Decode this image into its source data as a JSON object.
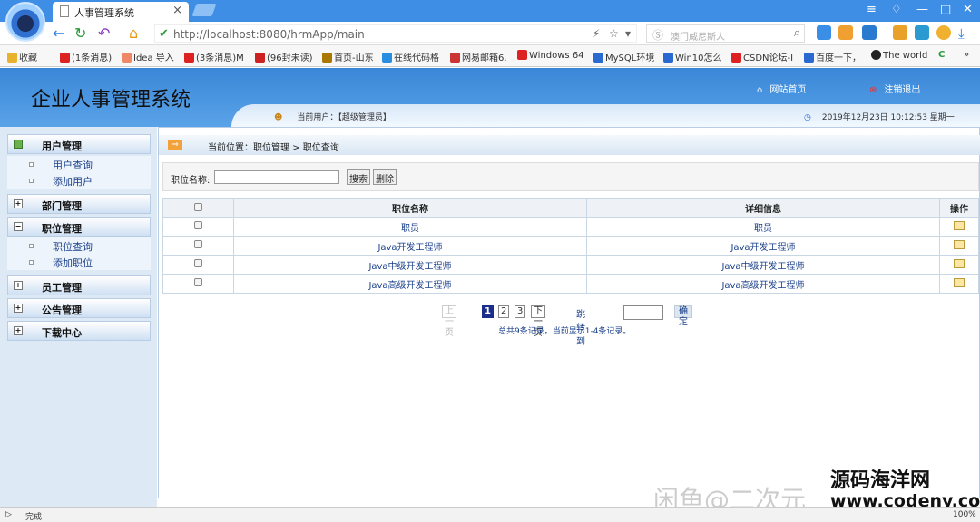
{
  "browser": {
    "tab_title": "人事管理系统",
    "tab_close": "×",
    "url_host": "http://localhost:8080",
    "url_path": "/hrmApp/main",
    "search_placeholder": "澳门威尼斯人",
    "min": "—",
    "max": "□",
    "close": "✕"
  },
  "bookmarks": [
    {
      "label": "收藏",
      "color": "#e8b22f"
    },
    {
      "label": "(1条消息)",
      "color": "#d22"
    },
    {
      "label": "Idea 导入",
      "color": "#e86"
    },
    {
      "label": "(3条消息)M",
      "color": "#d22"
    },
    {
      "label": "(96封未读)",
      "color": "#c22"
    },
    {
      "label": "首页-山东",
      "color": "#a70"
    },
    {
      "label": "在线代码格",
      "color": "#2a8ee0"
    },
    {
      "label": "网易邮箱6.",
      "color": "#c33"
    },
    {
      "label": "Windows 64",
      "color": "#d22"
    },
    {
      "label": "MySQL环境",
      "color": "#2a6ad0"
    },
    {
      "label": "Win10怎么",
      "color": "#2a6ad0"
    },
    {
      "label": "CSDN论坛-I",
      "color": "#d22"
    },
    {
      "label": "百度一下，",
      "color": "#2a6ad0"
    },
    {
      "label": "The world",
      "color": "#222"
    }
  ],
  "header": {
    "title": "企业人事管理系统",
    "home_label": "网站首页",
    "logout_label": "注销退出",
    "user_label": "当前用户：【超级管理员】",
    "datetime": "2019年12月23日  10:12:53  星期一"
  },
  "sidebar": {
    "sections": [
      {
        "label": "用户管理",
        "items": [
          "用户查询",
          "添加用户"
        ]
      },
      {
        "label": "部门管理"
      },
      {
        "label": "职位管理",
        "items": [
          "职位查询",
          "添加职位"
        ]
      },
      {
        "label": "员工管理"
      },
      {
        "label": "公告管理"
      },
      {
        "label": "下载中心"
      }
    ]
  },
  "breadcrumb": "当前位置：职位管理 > 职位查询",
  "form": {
    "name_label": "职位名称:",
    "name_value": "",
    "search": "搜索",
    "delete": "删除"
  },
  "table": {
    "headers": [
      "职位名称",
      "详细信息",
      "操作"
    ],
    "rows": [
      [
        "职员",
        "职员"
      ],
      [
        "Java开发工程师",
        "Java开发工程师"
      ],
      [
        "Java中级开发工程师",
        "Java中级开发工程师"
      ],
      [
        "Java高级开发工程师",
        "Java高级开发工程师"
      ]
    ]
  },
  "pager": {
    "prev": "上一页",
    "pages": [
      "1",
      "2",
      "3"
    ],
    "next": "下一页",
    "jump_label": "跳转到",
    "jump_value": "",
    "confirm": "确定",
    "summary": "总共9条记录，当前显示1-4条记录。"
  },
  "status": {
    "left": "完成",
    "zoom": "100%"
  },
  "watermark": {
    "left": "闲鱼@二次元",
    "right_top": "源码海洋网",
    "right_bottom": "www.codeny.com"
  }
}
